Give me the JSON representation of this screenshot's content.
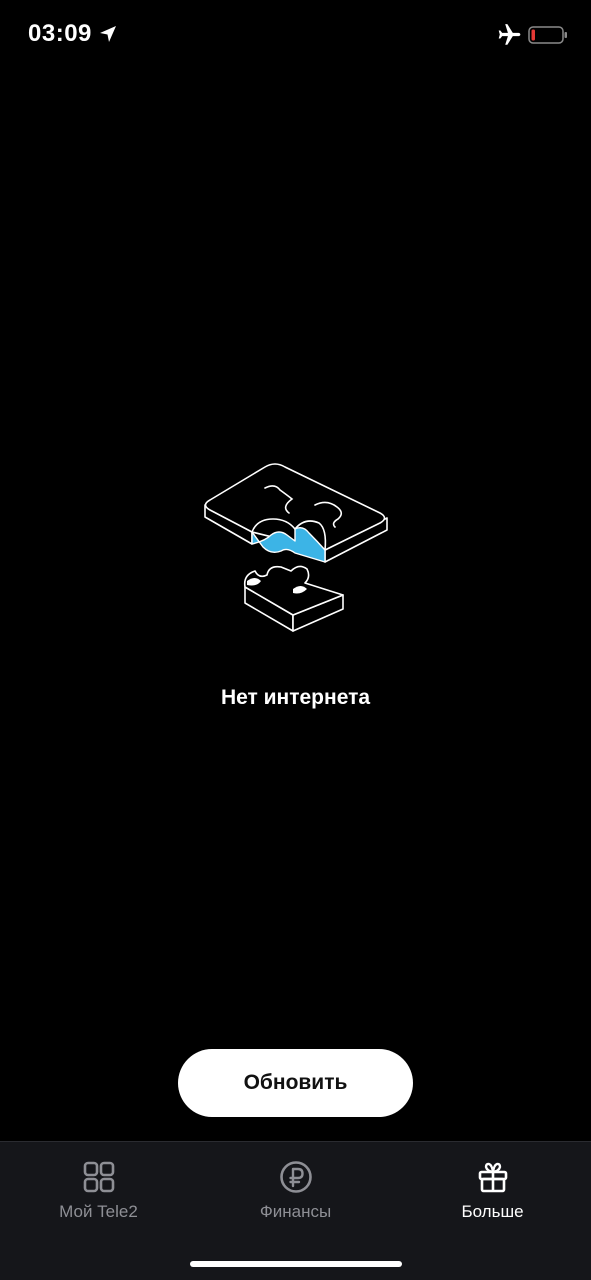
{
  "status_bar": {
    "time": "03:09",
    "icons": [
      "location-icon",
      "airplane-icon",
      "battery-icon"
    ],
    "battery_color": "#e53935"
  },
  "main": {
    "illustration_icon": "puzzle-illustration",
    "accent_color": "#3cb4e6",
    "message": "Нет интернета",
    "refresh_label": "Обновить"
  },
  "tab_bar": {
    "items": [
      {
        "label": "Мой Tele2",
        "icon": "grid-icon",
        "active": false
      },
      {
        "label": "Финансы",
        "icon": "ruble-icon",
        "active": false
      },
      {
        "label": "Больше",
        "icon": "gift-icon",
        "active": true
      }
    ]
  }
}
